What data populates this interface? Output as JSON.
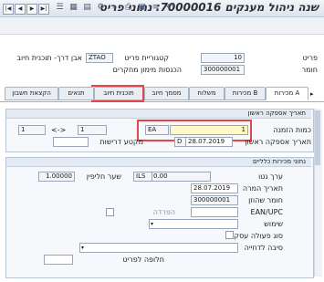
{
  "title": "שנה ניהול מענקים 70000016: נתוני פריט",
  "header": {
    "item_label": "פריט",
    "item_value": "10",
    "category_label": "קטגוריית פריט",
    "category_value": "ZTAO",
    "category_desc": "אבן דרך- תוכנית חיוב",
    "material_label": "חומר",
    "material_value": "300000001",
    "material_desc": "הכנסות מימון מחקרים"
  },
  "tabs": [
    "מכירות A",
    "מכירות B",
    "משלוח",
    "מסמך חיוב",
    "תוכנית חיוב",
    "תנאים",
    "הקצאת חשבון"
  ],
  "order_group": {
    "title": "תאריך אספקה ראשון",
    "qty_label": "כמות הזמנה",
    "qty_value": "1",
    "uom_value": "EA",
    "conv_left": "1",
    "conv_arrow": "<->",
    "conv_right": "1",
    "date_label": "תאריך אספקה ראשון",
    "date_prefix": "D",
    "date_value": "28.07.2019",
    "req_label": "מקטע דרישות"
  },
  "general_group": {
    "title": "נתוני מכירות כלליים",
    "net_label": "ערך נטו",
    "net_value": "0.00",
    "currency": "ILS",
    "rate_label": "שער חליפין",
    "rate_value": "1.00000",
    "pricing_date_label": "תאריך המרה",
    "pricing_date_value": "28.07.2019",
    "customer_material_label": "חומר שהוזן",
    "customer_material_value": "300000001",
    "ean_label": "EAN/UPC",
    "delivery_label": "הפרדה",
    "usage_label": "שימוש",
    "business_label": "סוג פעולה עסקית",
    "reason_label": "סיבה לדחייה",
    "alt_label": "חלופה לפריט"
  },
  "toolbar_icons": [
    "back-icon",
    "list-icon",
    "save-icon",
    "print-icon",
    "find-icon",
    "settings-icon",
    "display-icon",
    "details-icon",
    "header-icon",
    "next-icon"
  ]
}
